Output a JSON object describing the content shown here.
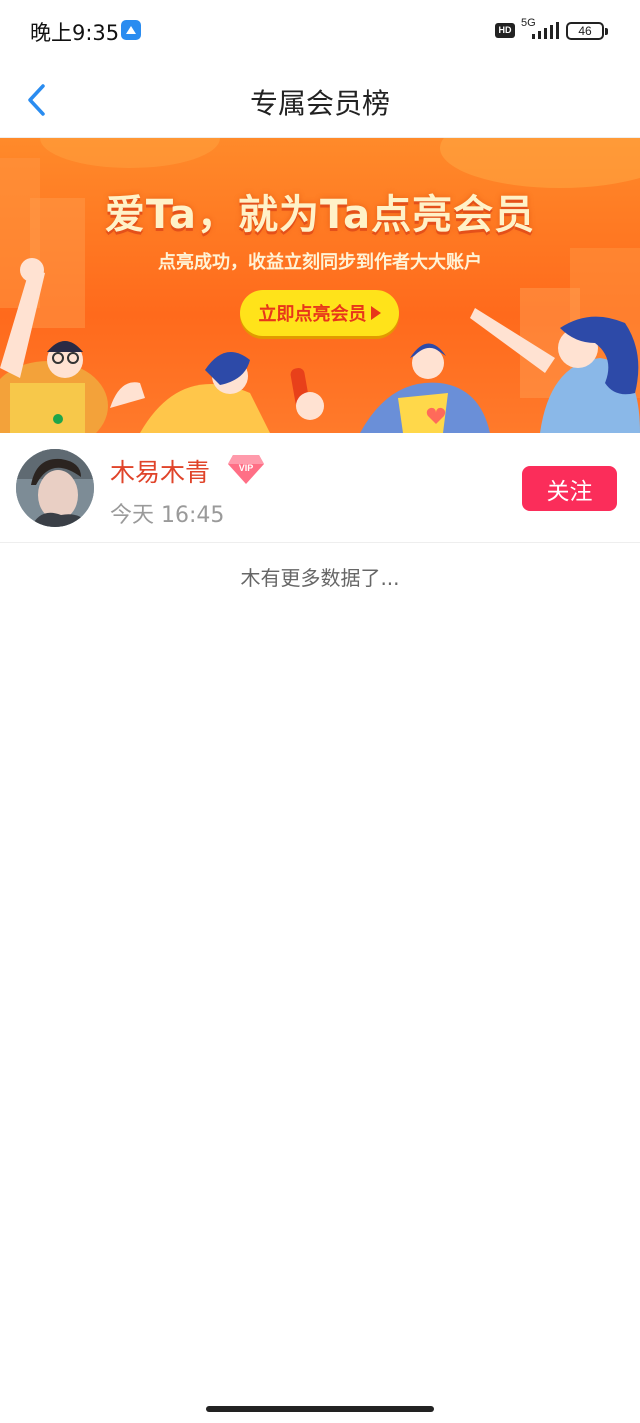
{
  "status_bar": {
    "time": "晚上9:35",
    "hd_label": "HD",
    "network_label": "5G",
    "battery_level": "46",
    "icons": [
      "app-notification-icon",
      "hd-icon",
      "signal-icon",
      "battery-icon"
    ]
  },
  "nav": {
    "back_icon": "chevron-left-icon",
    "title": "专属会员榜"
  },
  "banner": {
    "headline": "爱Ta，就为Ta点亮会员",
    "subtitle": "点亮成功，收益立刻同步到作者大大账户",
    "cta_label": "立即点亮会员",
    "colors": {
      "background": "#ff7a2b",
      "cta": "#ffe31a",
      "cta_text": "#e8361a"
    }
  },
  "members": [
    {
      "name": "木易木青",
      "vip_badge": "VIP",
      "time": "今天 16:45",
      "follow_label": "关注"
    }
  ],
  "footer_text": "木有更多数据了...",
  "colors": {
    "accent_blue": "#2a8cf0",
    "name_red": "#e0442a",
    "follow_button": "#fb2d5a"
  }
}
